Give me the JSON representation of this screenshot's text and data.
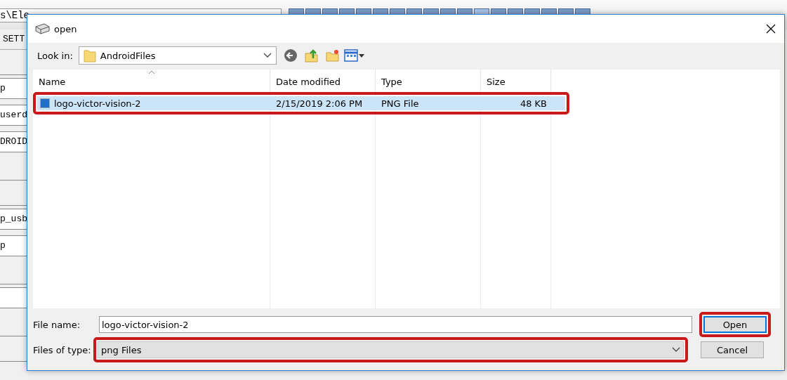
{
  "background_app": {
    "path_field": "s\\Ele",
    "tab_squares": [
      {
        "selected": false
      },
      {
        "selected": false
      },
      {
        "selected": false
      },
      {
        "selected": false
      },
      {
        "selected": false
      },
      {
        "selected": false
      },
      {
        "selected": false
      },
      {
        "selected": false
      },
      {
        "selected": false
      },
      {
        "selected": false
      },
      {
        "selected": false
      },
      {
        "selected": true
      },
      {
        "selected": false
      },
      {
        "selected": false
      },
      {
        "selected": false
      },
      {
        "selected": false
      },
      {
        "selected": false
      },
      {
        "selected": false
      }
    ],
    "left_fields": [
      {
        "kind": "label",
        "text": "SETT"
      },
      {
        "kind": "blank"
      },
      {
        "kind": "field",
        "text": "p"
      },
      {
        "kind": "field",
        "text": "userd"
      },
      {
        "kind": "field",
        "text": "DROID"
      },
      {
        "kind": "blank"
      },
      {
        "kind": "blank"
      },
      {
        "kind": "field",
        "text": "p_usb"
      },
      {
        "kind": "field",
        "text": "p"
      },
      {
        "kind": "blank"
      },
      {
        "kind": "field"
      },
      {
        "kind": "blank"
      },
      {
        "kind": "blank"
      }
    ]
  },
  "window": {
    "title": "open"
  },
  "look_in": {
    "label": "Look in:",
    "value": "AndroidFiles"
  },
  "table": {
    "columns": [
      "Name",
      "Date modified",
      "Type",
      "Size"
    ],
    "rows": [
      {
        "name": "logo-victor-vision-2",
        "date": "2/15/2019 2:06 PM",
        "type": "PNG File",
        "size": "48 KB",
        "selected": true,
        "highlighted": true
      }
    ]
  },
  "file_name": {
    "label": "File name:",
    "value": "logo-victor-vision-2"
  },
  "file_type": {
    "label": "Files of type:",
    "value": "png Files",
    "highlighted": true
  },
  "buttons": [
    {
      "label": "Open",
      "default": true,
      "highlighted": true
    },
    {
      "label": "Cancel",
      "default": false,
      "highlighted": false
    }
  ]
}
